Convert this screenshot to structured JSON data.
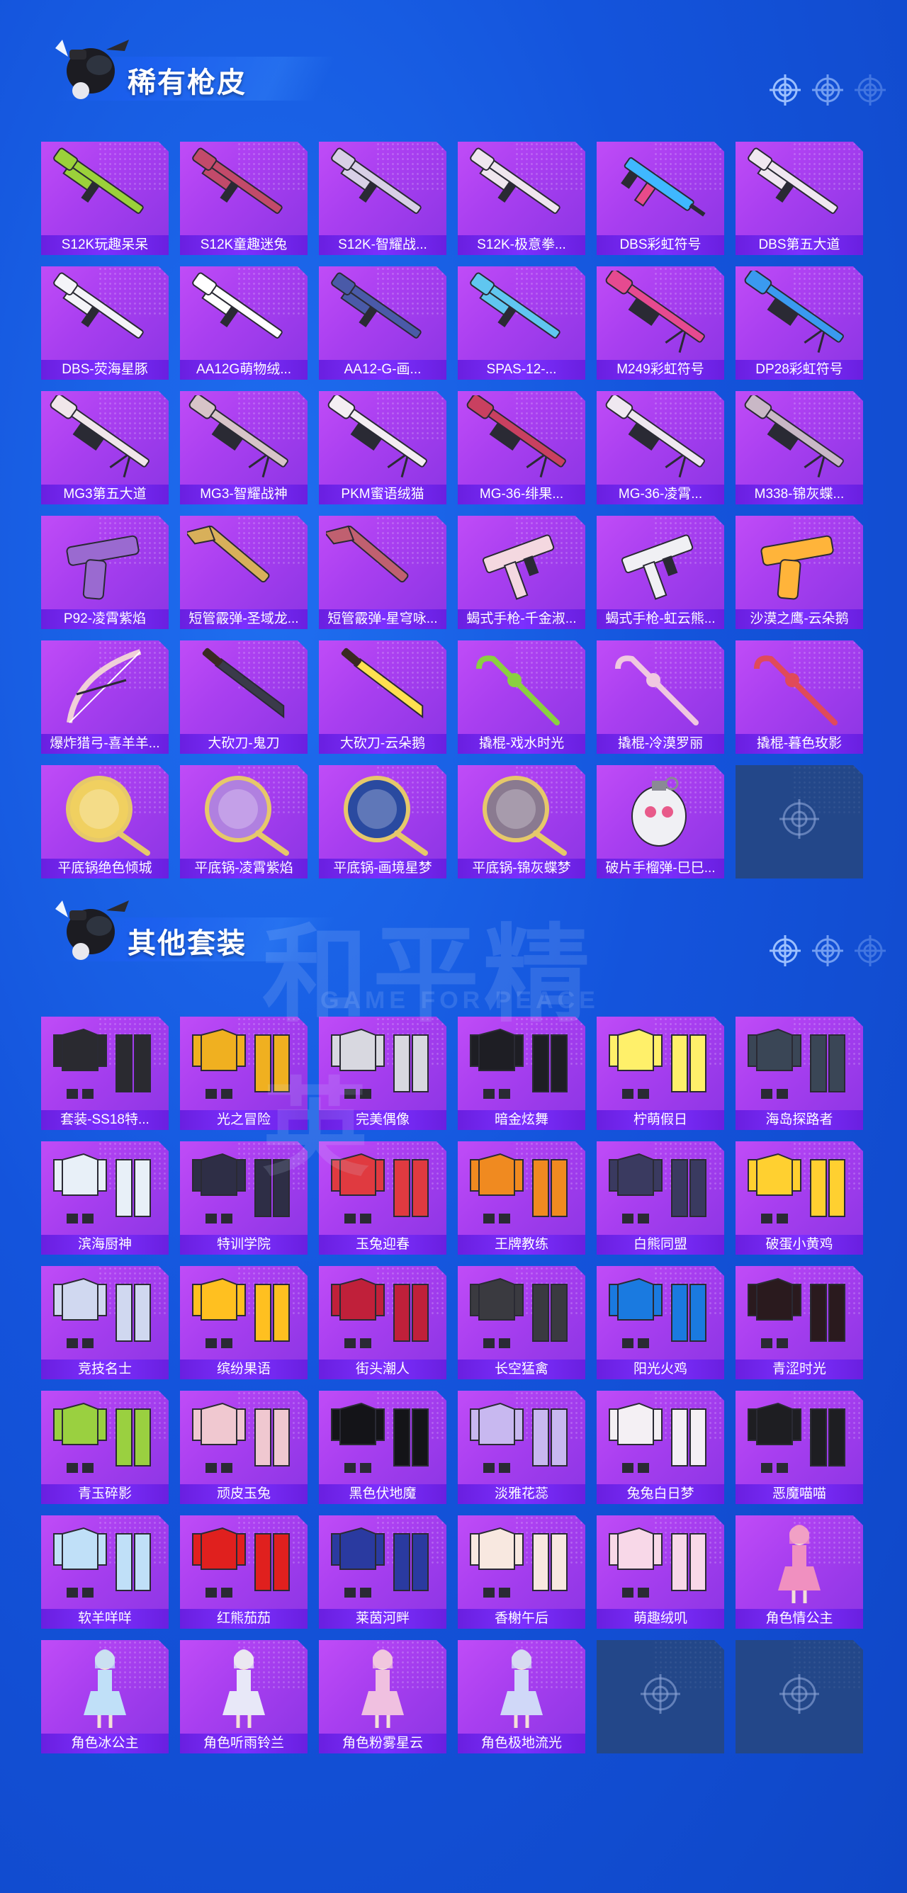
{
  "sections": [
    {
      "title": "稀有枪皮",
      "items": [
        {
          "label": "S12K玩趣呆呆",
          "icon": "shotgun-icon",
          "color": "#9bd13a"
        },
        {
          "label": "S12K童趣迷兔",
          "icon": "shotgun-icon",
          "color": "#c24a6a"
        },
        {
          "label": "S12K-智耀战...",
          "icon": "shotgun-icon",
          "color": "#d8d0e6"
        },
        {
          "label": "S12K-极意拳...",
          "icon": "shotgun-icon",
          "color": "#efe6ee"
        },
        {
          "label": "DBS彩虹符号",
          "icon": "smg-icon",
          "color": "#3fb8ff"
        },
        {
          "label": "DBS第五大道",
          "icon": "shotgun-icon",
          "color": "#f0e8f0"
        },
        {
          "label": "DBS-荧海星豚",
          "icon": "shotgun-icon",
          "color": "#f4f4f8"
        },
        {
          "label": "AA12G萌物绒...",
          "icon": "shotgun-icon",
          "color": "#ffffff"
        },
        {
          "label": "AA12-G-画...",
          "icon": "shotgun-icon",
          "color": "#4a5aa8"
        },
        {
          "label": "SPAS-12-...",
          "icon": "shotgun-icon",
          "color": "#60c6f0"
        },
        {
          "label": "M249彩虹符号",
          "icon": "lmg-icon",
          "color": "#e64a90"
        },
        {
          "label": "DP28彩虹符号",
          "icon": "lmg-icon",
          "color": "#3a9af0"
        },
        {
          "label": "MG3第五大道",
          "icon": "lmg-icon",
          "color": "#f0e6ea"
        },
        {
          "label": "MG3-智耀战神",
          "icon": "lmg-icon",
          "color": "#d7c4c8"
        },
        {
          "label": "PKM蜜语绒猫",
          "icon": "lmg-icon",
          "color": "#f4eef2"
        },
        {
          "label": "MG-36-绯果...",
          "icon": "lmg-icon",
          "color": "#c94060"
        },
        {
          "label": "MG-36-凌霄...",
          "icon": "lmg-icon",
          "color": "#efe8f0"
        },
        {
          "label": "M338-锦灰蝶...",
          "icon": "lmg-icon",
          "color": "#c9b8c6"
        },
        {
          "label": "P92-凌霄紫焰",
          "icon": "pistol-icon",
          "color": "#9a6ad0"
        },
        {
          "label": "短管霰弹-圣域龙...",
          "icon": "sawed-off-icon",
          "color": "#d8b05a"
        },
        {
          "label": "短管霰弹-星穹咏...",
          "icon": "sawed-off-icon",
          "color": "#c06070"
        },
        {
          "label": "蝎式手枪-千金淑...",
          "icon": "machine-pistol-icon",
          "color": "#f4d8e0"
        },
        {
          "label": "蝎式手枪-虹云熊...",
          "icon": "machine-pistol-icon",
          "color": "#f0f0f4"
        },
        {
          "label": "沙漠之鹰-云朵鹅",
          "icon": "pistol-icon",
          "color": "#ffb43a"
        },
        {
          "label": "爆炸猎弓-喜羊羊...",
          "icon": "bow-icon",
          "color": "#f0d0d8"
        },
        {
          "label": "大砍刀-鬼刀",
          "icon": "machete-icon",
          "color": "#3a3a4a"
        },
        {
          "label": "大砍刀-云朵鹅",
          "icon": "machete-icon",
          "color": "#ffe050"
        },
        {
          "label": "撬棍-戏水时光",
          "icon": "crowbar-icon",
          "color": "#8ad040"
        },
        {
          "label": "撬棍-冷漠罗丽",
          "icon": "crowbar-icon",
          "color": "#f0c8e0"
        },
        {
          "label": "撬棍-暮色玫影",
          "icon": "crowbar-icon",
          "color": "#e04a5a"
        },
        {
          "label": "平底锅绝色倾城",
          "icon": "pan-icon",
          "color": "#f0d060"
        },
        {
          "label": "平底锅-凌霄紫焰",
          "icon": "pan-icon",
          "color": "#b080e0"
        },
        {
          "label": "平底锅-画境星梦",
          "icon": "pan-icon",
          "color": "#2a4aa0"
        },
        {
          "label": "平底锅-锦灰蝶梦",
          "icon": "pan-icon",
          "color": "#8a7a90"
        },
        {
          "label": "破片手榴弹-巳巳...",
          "icon": "grenade-icon",
          "color": "#f0f0f4"
        }
      ],
      "empty_slots": 1
    },
    {
      "title": "其他套装",
      "items": [
        {
          "label": "套装-SS18特...",
          "icon": "outfit-icon",
          "color": "#2a2a30"
        },
        {
          "label": "光之冒险",
          "icon": "outfit-icon",
          "color": "#f0b020"
        },
        {
          "label": "完美偶像",
          "icon": "outfit-icon",
          "color": "#d8d8e0"
        },
        {
          "label": "暗金炫舞",
          "icon": "outfit-icon",
          "color": "#1e1e24"
        },
        {
          "label": "柠萌假日",
          "icon": "outfit-icon",
          "color": "#fff06a"
        },
        {
          "label": "海岛探路者",
          "icon": "outfit-icon",
          "color": "#3a4656"
        },
        {
          "label": "滨海厨神",
          "icon": "outfit-icon",
          "color": "#e8f0f8"
        },
        {
          "label": "特训学院",
          "icon": "outfit-icon",
          "color": "#2e2e46"
        },
        {
          "label": "玉兔迎春",
          "icon": "outfit-icon",
          "color": "#e03a40"
        },
        {
          "label": "王牌教练",
          "icon": "outfit-icon",
          "color": "#f08a20"
        },
        {
          "label": "白熊同盟",
          "icon": "outfit-icon",
          "color": "#3a3a60"
        },
        {
          "label": "破蛋小黄鸡",
          "icon": "outfit-icon",
          "color": "#ffd030"
        },
        {
          "label": "竞技名士",
          "icon": "outfit-icon",
          "color": "#d0d8f0"
        },
        {
          "label": "缤纷果语",
          "icon": "outfit-icon",
          "color": "#ffc020"
        },
        {
          "label": "街头潮人",
          "icon": "outfit-icon",
          "color": "#c0203a"
        },
        {
          "label": "长空猛禽",
          "icon": "outfit-icon",
          "color": "#3a3a40"
        },
        {
          "label": "阳光火鸡",
          "icon": "outfit-icon",
          "color": "#1a7ae0"
        },
        {
          "label": "青涩时光",
          "icon": "outfit-icon",
          "color": "#2a1a1e"
        },
        {
          "label": "青玉碎影",
          "icon": "outfit-icon",
          "color": "#9ad040"
        },
        {
          "label": "顽皮玉兔",
          "icon": "outfit-icon",
          "color": "#f0c8d0"
        },
        {
          "label": "黑色伏地魔",
          "icon": "outfit-icon",
          "color": "#141418"
        },
        {
          "label": "淡雅花蕊",
          "icon": "outfit-icon",
          "color": "#c8b8f0"
        },
        {
          "label": "兔兔白日梦",
          "icon": "outfit-icon",
          "color": "#f4f0f4"
        },
        {
          "label": "恶魔喵喵",
          "icon": "outfit-icon",
          "color": "#1e1e22"
        },
        {
          "label": "软羊咩咩",
          "icon": "outfit-icon",
          "color": "#c0e0f8"
        },
        {
          "label": "红熊茄茄",
          "icon": "outfit-icon",
          "color": "#e0201e"
        },
        {
          "label": "莱茵河畔",
          "icon": "outfit-icon",
          "color": "#2a3aa0"
        },
        {
          "label": "香榭午后",
          "icon": "outfit-icon",
          "color": "#f8e8e0"
        },
        {
          "label": "萌趣绒叽",
          "icon": "outfit-icon",
          "color": "#f8d8e8"
        },
        {
          "label": "角色情公主",
          "icon": "character-icon",
          "color": "#f090c0"
        },
        {
          "label": "角色冰公主",
          "icon": "character-icon",
          "color": "#c0e0f8"
        },
        {
          "label": "角色听雨铃兰",
          "icon": "character-icon",
          "color": "#e8e8f8"
        },
        {
          "label": "角色粉雾星云",
          "icon": "character-icon",
          "color": "#f0c0e0"
        },
        {
          "label": "角色极地流光",
          "icon": "character-icon",
          "color": "#d0d8f8"
        }
      ],
      "empty_slots": 2
    }
  ],
  "watermark": {
    "main": "和平精英",
    "sub": "GAME FOR PEACE"
  }
}
